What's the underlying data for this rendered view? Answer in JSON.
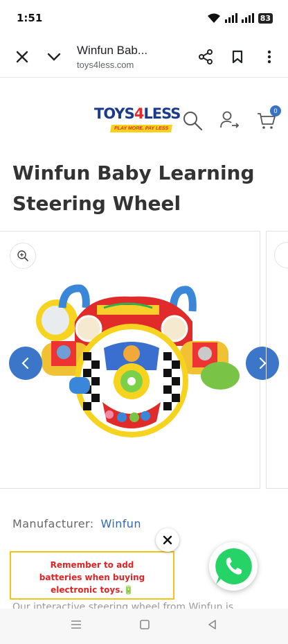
{
  "status_bar": {
    "time": "1:51",
    "battery": "83"
  },
  "browser": {
    "title": "Winfun Bab...",
    "url": "toys4less.com"
  },
  "site": {
    "logo_main": "TOYS",
    "logo_four": "4",
    "logo_end": "LESS",
    "logo_tagline": "PLAY MORE. PAY LESS",
    "cart_count": "0"
  },
  "product": {
    "title": "Winfun Baby Learning Steering Wheel",
    "manufacturer_label": "Manufacturer:",
    "manufacturer_value": "Winfun",
    "description_start": "Our interactive steering wheel from Winfun is"
  },
  "notice": {
    "line1": "Remember to add",
    "line2": "batteries when buying",
    "line3": "electronic toys.🔋"
  },
  "colors": {
    "accent": "#3b76c9",
    "notice_border": "#f2c418",
    "notice_text": "#e02424",
    "whatsapp": "#25d366"
  }
}
